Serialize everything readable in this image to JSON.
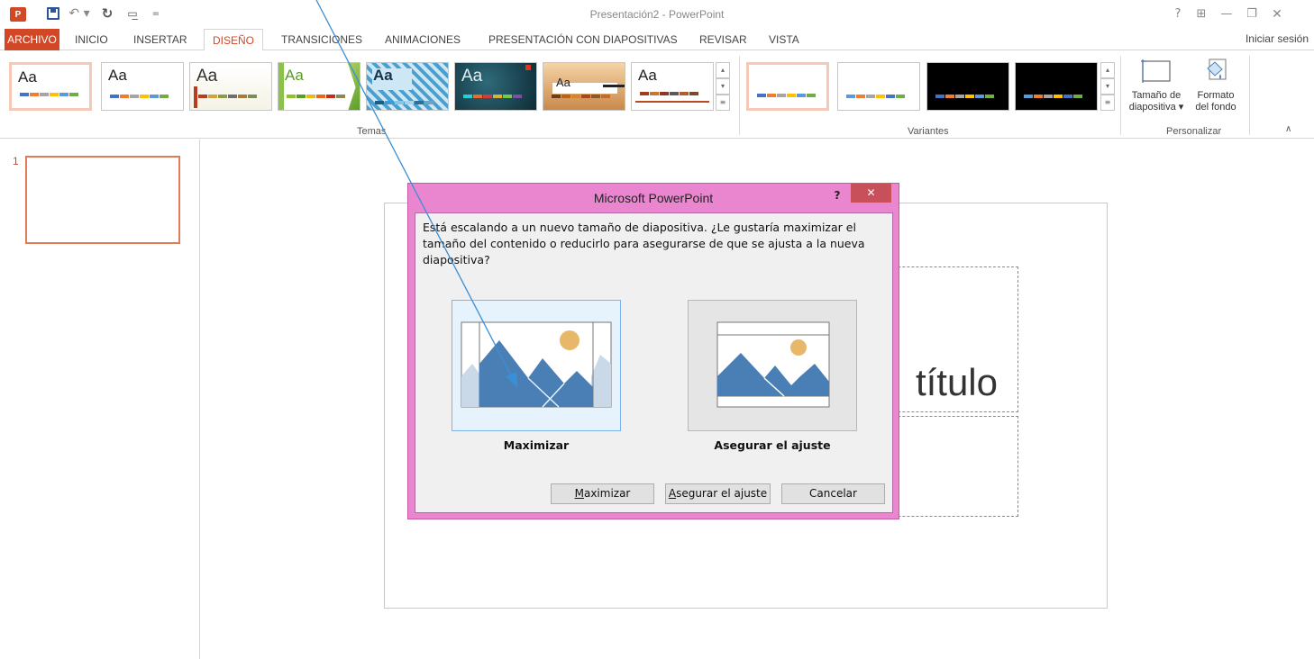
{
  "window": {
    "title": "Presentación2 - PowerPoint",
    "app_icon_text": "P",
    "help": "?",
    "ribbon_display": "⊞",
    "minimize": "—",
    "restore": "❐",
    "close": "✕",
    "signin": "Iniciar sesión"
  },
  "quick_access": {
    "undo": "↶ ▾",
    "redo": "↻",
    "start_show": "▭̲",
    "customize": "="
  },
  "tabs": {
    "archivo": "ARCHIVO",
    "inicio": "INICIO",
    "insertar": "INSERTAR",
    "diseno": "DISEÑO",
    "transiciones": "TRANSICIONES",
    "animaciones": "ANIMACIONES",
    "presentacion": "PRESENTACIÓN CON DIAPOSITIVAS",
    "revisar": "REVISAR",
    "vista": "VISTA",
    "active": "DISEÑO"
  },
  "ribbon": {
    "themes_label": "Temas",
    "themes_sample_text": "Aa",
    "variants_label": "Variantes",
    "customize_label": "Personalizar",
    "slide_size": {
      "line1": "Tamaño de",
      "line2": "diapositiva ▾"
    },
    "background_format": {
      "line1": "Formato",
      "line2": "del fondo"
    },
    "collapse": "∧"
  },
  "slide_pane": {
    "slide_number": "1"
  },
  "slide": {
    "title_fragment": "título"
  },
  "dialog": {
    "title": "Microsoft PowerPoint",
    "help": "?",
    "close": "✕",
    "message": "Está escalando a un nuevo tamaño de diapositiva. ¿Le gustaría maximizar el tamaño del contenido o reducirlo para asegurarse de que se ajusta a la nueva diapositiva?",
    "option_maximize_label": "Maximizar",
    "option_ensure_label": "Asegurar el ajuste",
    "buttons": {
      "maximize_first": "M",
      "maximize_rest": "aximizar",
      "ensure_first": "A",
      "ensure_rest": "segurar el ajuste",
      "cancel": "Cancelar"
    }
  },
  "colors": {
    "accent": "#d24726",
    "dialog_frame": "#ea86cf",
    "dialog_close": "#c7505a",
    "mountain": "#4a7fb5",
    "sun": "#e8b86a",
    "arrow": "#3b8fd6"
  }
}
